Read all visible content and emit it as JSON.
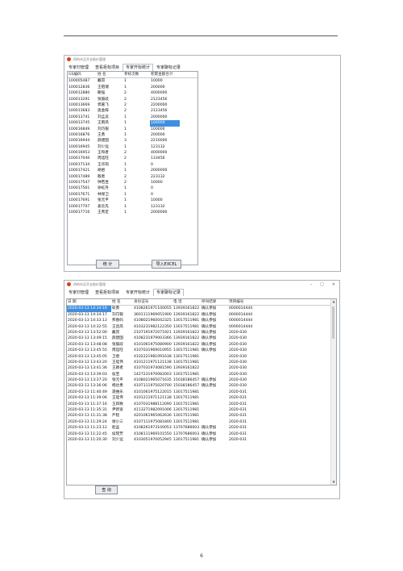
{
  "window1": {
    "title": "四的市买开支助价管理",
    "tabs": [
      "专家归管理",
      "查看拒标项目",
      "专家开标统计",
      "专家聊标记录"
    ],
    "active_tab": 2,
    "columns": [
      "GS编码",
      "姓 名",
      "参标次数",
      "积累金额合计"
    ],
    "rows": [
      [
        "100005487",
        "戴昂",
        "1",
        "10000"
      ],
      [
        "100012836",
        "王陌瑞",
        "1",
        "200000"
      ],
      [
        "100012880",
        "朝强",
        "2",
        "4000000"
      ],
      [
        "100013291",
        "张鼓歧",
        "2",
        "2123456"
      ],
      [
        "100013669",
        "郭嘉飞",
        "2",
        "2200000"
      ],
      [
        "100013683",
        "奥金辉",
        "2",
        "2123456"
      ],
      [
        "100013741",
        "刘孟竞",
        "1",
        "2000000"
      ],
      [
        "100013745",
        "王雨凤",
        "1",
        "100000"
      ],
      [
        "100016849",
        "刘巧银",
        "1",
        "100000"
      ],
      [
        "100016876",
        "王勇",
        "1",
        "200000"
      ],
      [
        "100016944",
        "薛建国",
        "3",
        "2210000"
      ],
      [
        "100016945",
        "刘少远",
        "1",
        "123132"
      ],
      [
        "100016953",
        "王和者",
        "2",
        "4000000"
      ],
      [
        "100017040",
        "周廷旺",
        "2",
        "133456"
      ],
      [
        "100017134",
        "王华岗",
        "1",
        "0"
      ],
      [
        "100017421",
        "胡君",
        "1",
        "2000000"
      ],
      [
        "100017489",
        "敌者",
        "2",
        "223132"
      ],
      [
        "100017547",
        "钟若昱",
        "2",
        "10000"
      ],
      [
        "100017561",
        "徐虹丹",
        "1",
        "0"
      ],
      [
        "100017671",
        "林保卫",
        "1",
        "0"
      ],
      [
        "100017691",
        "张元平",
        "1",
        "10000"
      ],
      [
        "100017707",
        "姜云先",
        "1",
        "123132"
      ],
      [
        "100017716",
        "王青定",
        "1",
        "2000000"
      ]
    ],
    "button_left": "统 计",
    "button_right": "导入EXCEL"
  },
  "window2": {
    "title": "四的市买开支助价管理",
    "tabs": [
      "专家归管理",
      "查看拒标项目",
      "专家开标统计",
      "专家聊标记录"
    ],
    "active_tab": 3,
    "columns": [
      "日 期",
      "姓 名",
      "身份证号",
      "电 话",
      "呼叫结果",
      "项目编号"
    ],
    "rows": [
      [
        "2020-03-13 14:34:19",
        "耿勇",
        "4108261971100055",
        "13939161822",
        "确认参加",
        "0000014444"
      ],
      [
        "2020-03-13 14:34:17",
        "刘巧银",
        "3601111969051900",
        "13939161822",
        "确认参加",
        "0000014444"
      ],
      [
        "2020-03-13 14:33:13",
        "邦春码",
        "4108021960042325",
        "13017511981",
        "确认参加",
        "0000014444"
      ],
      [
        "2020-03-13 14:32:55",
        "王昌凤",
        "4103231982122350",
        "13017511981",
        "确认参加",
        "0000014444"
      ],
      [
        "2020-03-13 13:52:00",
        "戴昂",
        "2107191972071921",
        "13939161822",
        "确认参加",
        "2020-030"
      ],
      [
        "2020-03-13 13:49:15",
        "薛建国",
        "4108231979003366",
        "13939161822",
        "确认参加",
        "2020-030"
      ],
      [
        "2020-03-13 13:48:08",
        "张鼓歧",
        "4101061975080900",
        "13939161822",
        "确认参加",
        "2020-030"
      ],
      [
        "2020-03-13 13:45:55",
        "周廷旺",
        "4107031969010955",
        "13017511981",
        "确认参加",
        "2020-030"
      ],
      [
        "2020-03-13 13:45:05",
        "卫君",
        "4102221981091638",
        "13017511981",
        "",
        "2020-030"
      ],
      [
        "2020-03-13 13:43:20",
        "王硅伟",
        "4101211971121138",
        "13017511981",
        "",
        "2020-030"
      ],
      [
        "2020-03-13 13:41:36",
        "王颖者",
        "4107031974081590",
        "13939161822",
        "",
        "2020-030"
      ],
      [
        "2020-03-13 13:39:03",
        "侯宝",
        "1427231970082003",
        "13017511981",
        "",
        "2020-030"
      ],
      [
        "2020-03-13 13:37:20",
        "张元平",
        "4108021965071635",
        "15038186457",
        "确认参加",
        "2020-030"
      ],
      [
        "2020-03-13 13:36:06",
        "杨达勇",
        "4107111975020700",
        "15038186457",
        "确认参加",
        "2020-030"
      ],
      [
        "2020-03-13 11:40:49",
        "聂维乐",
        "4101061975122015",
        "13017511981",
        "",
        "2020-031"
      ],
      [
        "2020-03-13 11:39:06",
        "王硅伟",
        "4101211971121138",
        "13017511981",
        "",
        "2020-031"
      ],
      [
        "2020-03-13 11:37:16",
        "王四致",
        "4107031988112090",
        "13017511981",
        "",
        "2020-031"
      ],
      [
        "2020-03-13 11:35:31",
        "尹新宽",
        "4113271982091006",
        "13017511981",
        "",
        "2020-031"
      ],
      [
        "2020-03-13 11:31:38",
        "严程",
        "4201061965062636",
        "13017511981",
        "",
        "2020-031"
      ],
      [
        "2020-03-13 11:29:24",
        "谢小三",
        "4107111975081800",
        "13017511981",
        "",
        "2020-031"
      ],
      [
        "2020-03-13 11:23:12",
        "赵盆",
        "4108261973100053",
        "13707686003",
        "确认参加",
        "2020-031"
      ],
      [
        "2020-03-13 11:22:45",
        "侯瑶芳",
        "4108111969101550",
        "13707686003",
        "确认参加",
        "2020-031"
      ],
      [
        "2020-03-13 11:20:30",
        "刘少远",
        "4103051970052945",
        "13017511981",
        "确认参加",
        "2020-031"
      ]
    ],
    "button_left": "查 询"
  },
  "page_number": "6"
}
